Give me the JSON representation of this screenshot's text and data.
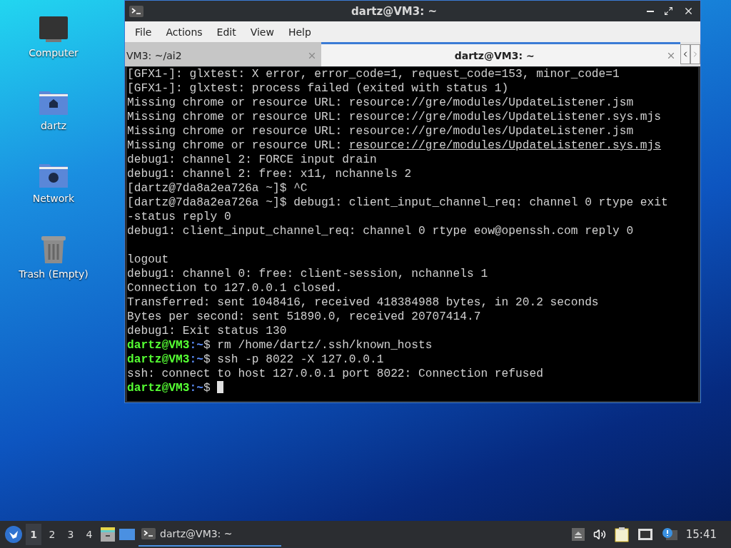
{
  "desktop_icons": [
    {
      "kind": "computer",
      "label": "Computer"
    },
    {
      "kind": "home",
      "label": "dartz"
    },
    {
      "kind": "network",
      "label": "Network"
    },
    {
      "kind": "trash",
      "label": "Trash (Empty)"
    }
  ],
  "window": {
    "title": "dartz@VM3: ~",
    "menu": [
      "File",
      "Actions",
      "Edit",
      "View",
      "Help"
    ],
    "tabs": [
      {
        "label": "VM3: ~/ai2",
        "selected": false
      },
      {
        "label": "dartz@VM3: ~",
        "selected": true
      }
    ],
    "terminal_lines": [
      {
        "kind": "plain",
        "text": "[GFX1-]: glxtest: X error, error_code=1, request_code=153, minor_code=1"
      },
      {
        "kind": "plain",
        "text": "[GFX1-]: glxtest: process failed (exited with status 1)"
      },
      {
        "kind": "plain",
        "text": "Missing chrome or resource URL: resource://gre/modules/UpdateListener.jsm"
      },
      {
        "kind": "plain",
        "text": "Missing chrome or resource URL: resource://gre/modules/UpdateListener.sys.mjs"
      },
      {
        "kind": "plain",
        "text": "Missing chrome or resource URL: resource://gre/modules/UpdateListener.jsm"
      },
      {
        "kind": "link",
        "text": "Missing chrome or resource URL: ",
        "link": "resource://gre/modules/UpdateListener.sys.mjs"
      },
      {
        "kind": "plain",
        "text": "debug1: channel 2: FORCE input drain"
      },
      {
        "kind": "plain",
        "text": "debug1: channel 2: free: x11, nchannels 2"
      },
      {
        "kind": "plain",
        "text": "[dartz@7da8a2ea726a ~]$ ^C"
      },
      {
        "kind": "plain",
        "text": "[dartz@7da8a2ea726a ~]$ debug1: client_input_channel_req: channel 0 rtype exit"
      },
      {
        "kind": "plain",
        "text": "-status reply 0"
      },
      {
        "kind": "plain",
        "text": "debug1: client_input_channel_req: channel 0 rtype eow@openssh.com reply 0"
      },
      {
        "kind": "blank"
      },
      {
        "kind": "plain",
        "text": "logout"
      },
      {
        "kind": "plain",
        "text": "debug1: channel 0: free: client-session, nchannels 1"
      },
      {
        "kind": "plain",
        "text": "Connection to 127.0.0.1 closed."
      },
      {
        "kind": "plain",
        "text": "Transferred: sent 1048416, received 418384988 bytes, in 20.2 seconds"
      },
      {
        "kind": "plain",
        "text": "Bytes per second: sent 51890.0, received 20707414.7"
      },
      {
        "kind": "plain",
        "text": "debug1: Exit status 130"
      },
      {
        "kind": "prompt",
        "host": "dartz@VM3",
        "path": ":~",
        "command": "$ rm /home/dartz/.ssh/known_hosts",
        "cursor": false
      },
      {
        "kind": "prompt",
        "host": "dartz@VM3",
        "path": ":~",
        "command": "$ ssh -p 8022 -X 127.0.0.1",
        "cursor": false
      },
      {
        "kind": "plain",
        "text": "ssh: connect to host 127.0.0.1 port 8022: Connection refused"
      },
      {
        "kind": "prompt",
        "host": "dartz@VM3",
        "path": ":~",
        "command": "$ ",
        "cursor": true
      }
    ]
  },
  "taskbar": {
    "workspaces": [
      {
        "label": "1",
        "selected": true
      },
      {
        "label": "2",
        "selected": false
      },
      {
        "label": "3",
        "selected": false
      },
      {
        "label": "4",
        "selected": false
      }
    ],
    "task": {
      "label": "dartz@VM3: ~",
      "selected": true
    },
    "clock": "15:41"
  }
}
